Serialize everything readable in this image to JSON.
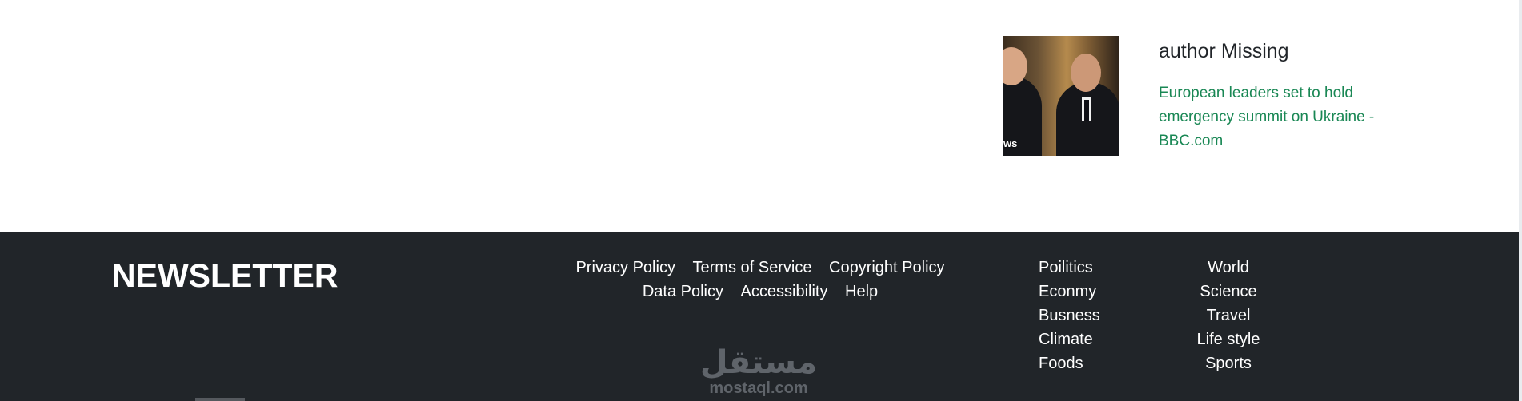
{
  "card": {
    "author": "author Missing",
    "link_text": "European leaders set to hold emergency summit on Ukraine - BBC.com",
    "thumb_tag": "ws"
  },
  "footer": {
    "newsletter_title": "NEWSLETTER",
    "policy_links": [
      "Privacy Policy",
      "Terms of Service",
      "Copyright Policy",
      "Data Policy",
      "Accessibility",
      "Help"
    ],
    "categories_col1": [
      "Poilitics",
      "Econmy",
      "Busness",
      "Climate",
      "Foods"
    ],
    "categories_col2": [
      "World",
      "Science",
      "Travel",
      "Life style",
      "Sports"
    ]
  },
  "watermark": {
    "arabic": "مستقل",
    "latin": "mostaql.com"
  },
  "colors": {
    "link": "#198754",
    "footer_bg": "#212529",
    "text_dark": "#212529"
  }
}
